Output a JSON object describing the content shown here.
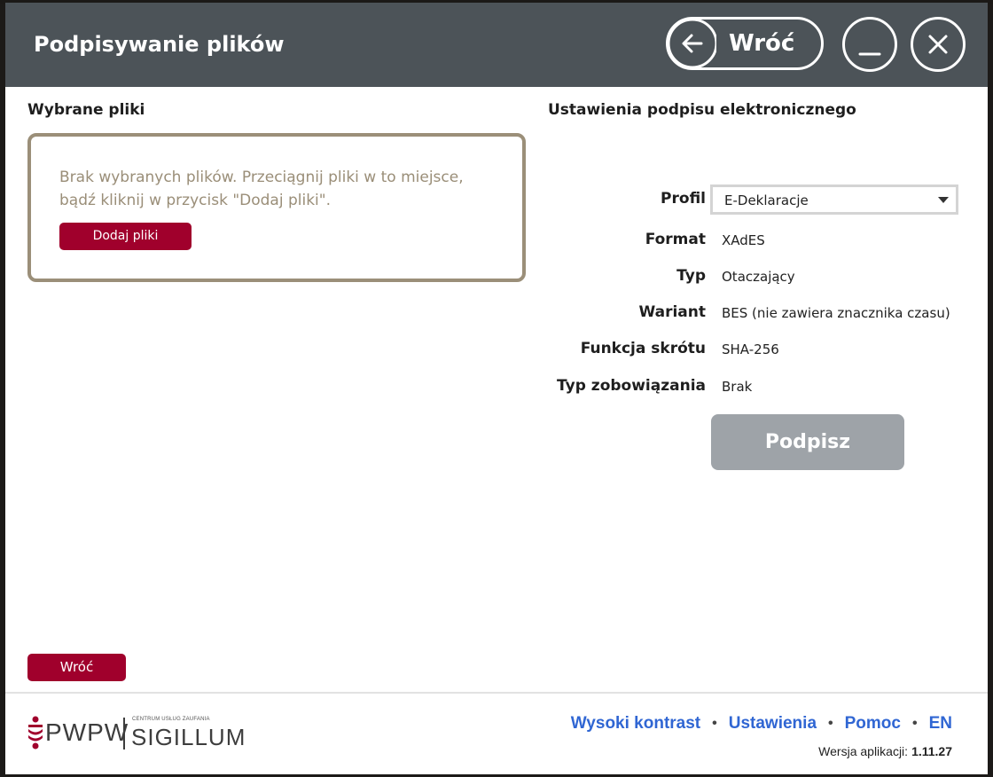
{
  "window": {
    "title": "Podpisywanie plików",
    "back_label": "Wróć",
    "minimize_label": "_"
  },
  "left": {
    "section_title": "Wybrane pliki",
    "empty_message": "Brak wybranych plików. Przeciągnij pliki w to miejsce, bądź kliknij w przycisk \"Dodaj pliki\".",
    "add_files_button": "Dodaj pliki",
    "back_button": "Wróć"
  },
  "right": {
    "section_title": "Ustawienia podpisu elektronicznego",
    "profile_label": "Profil",
    "profile_value": "E-Deklaracje",
    "rows": [
      {
        "label": "Format",
        "value": "XAdES"
      },
      {
        "label": "Typ",
        "value": "Otaczający"
      },
      {
        "label": "Wariant",
        "value": "BES (nie zawiera znacznika czasu)"
      },
      {
        "label": "Funkcja skrótu",
        "value": "SHA-256"
      },
      {
        "label": "Typ zobowiązania",
        "value": "Brak"
      }
    ],
    "sign_button": "Podpisz"
  },
  "footer": {
    "logo_pwpw": "PWPW",
    "logo_small": "CENTRUM USŁUG ZAUFANIA",
    "logo_sigillum": "SIGILLUM",
    "links": [
      "Wysoki kontrast",
      "Ustawienia",
      "Pomoc",
      "EN"
    ],
    "version_label": "Wersja aplikacji:",
    "version_number": "1.11.27"
  },
  "colors": {
    "titlebar": "#4c5358",
    "accent": "#a0002c",
    "dropzone_border": "#9b8f79",
    "link": "#3066d3",
    "disabled_button": "#9ea3a8"
  }
}
